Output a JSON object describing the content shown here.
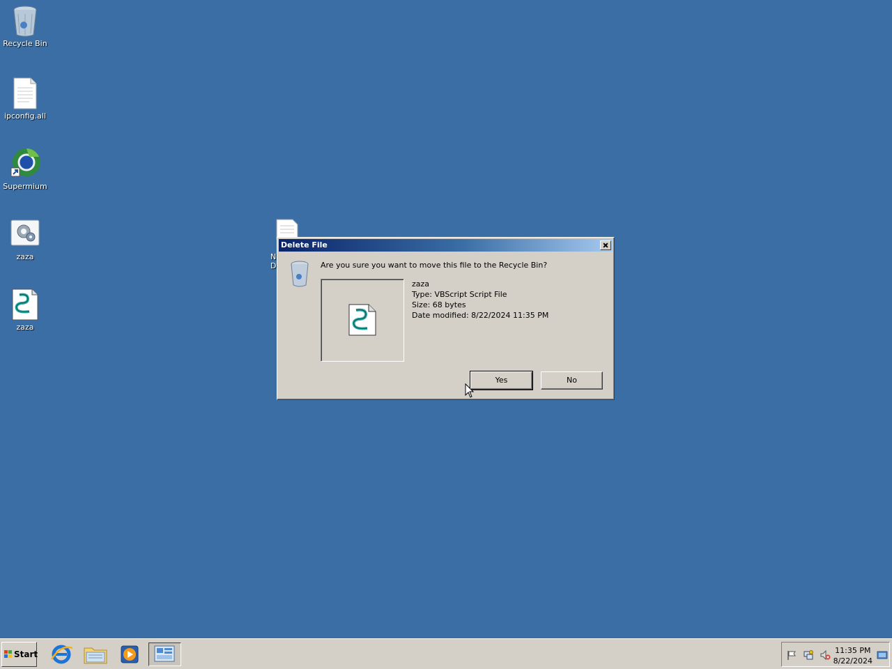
{
  "desktop": {
    "icons": [
      {
        "label": "Recycle Bin",
        "icon": "recycle-bin-icon"
      },
      {
        "label": "ipconfig.all",
        "icon": "text-file-icon"
      },
      {
        "label": "Supermium",
        "icon": "supermium-browser-icon"
      },
      {
        "label": "zaza",
        "icon": "settings-file-icon"
      },
      {
        "label": "zaza",
        "icon": "vbscript-file-icon"
      }
    ],
    "partial_icon_label": "Ne\nDo"
  },
  "dialog": {
    "title": "Delete File",
    "question": "Are you sure you want to move this file to the Recycle Bin?",
    "file": {
      "name": "zaza",
      "type": "Type: VBScript Script File",
      "size": "Size: 68 bytes",
      "modified": "Date modified: 8/22/2024 11:35 PM"
    },
    "yes_label": "Yes",
    "no_label": "No"
  },
  "taskbar": {
    "start_label": "Start",
    "quick_launch": [
      "internet-explorer-icon",
      "windows-explorer-icon",
      "media-player-icon",
      "server-manager-icon"
    ],
    "clock": {
      "time": "11:35 PM",
      "date": "8/22/2024"
    },
    "tray_icons": [
      "action-center-flag-icon",
      "network-icon",
      "volume-muted-icon",
      "show-desktop-icon"
    ]
  },
  "colors": {
    "desktop": "#3b6ea5",
    "titlebar_start": "#0a246a",
    "titlebar_end": "#a6caf0",
    "face": "#d4d0c8"
  }
}
